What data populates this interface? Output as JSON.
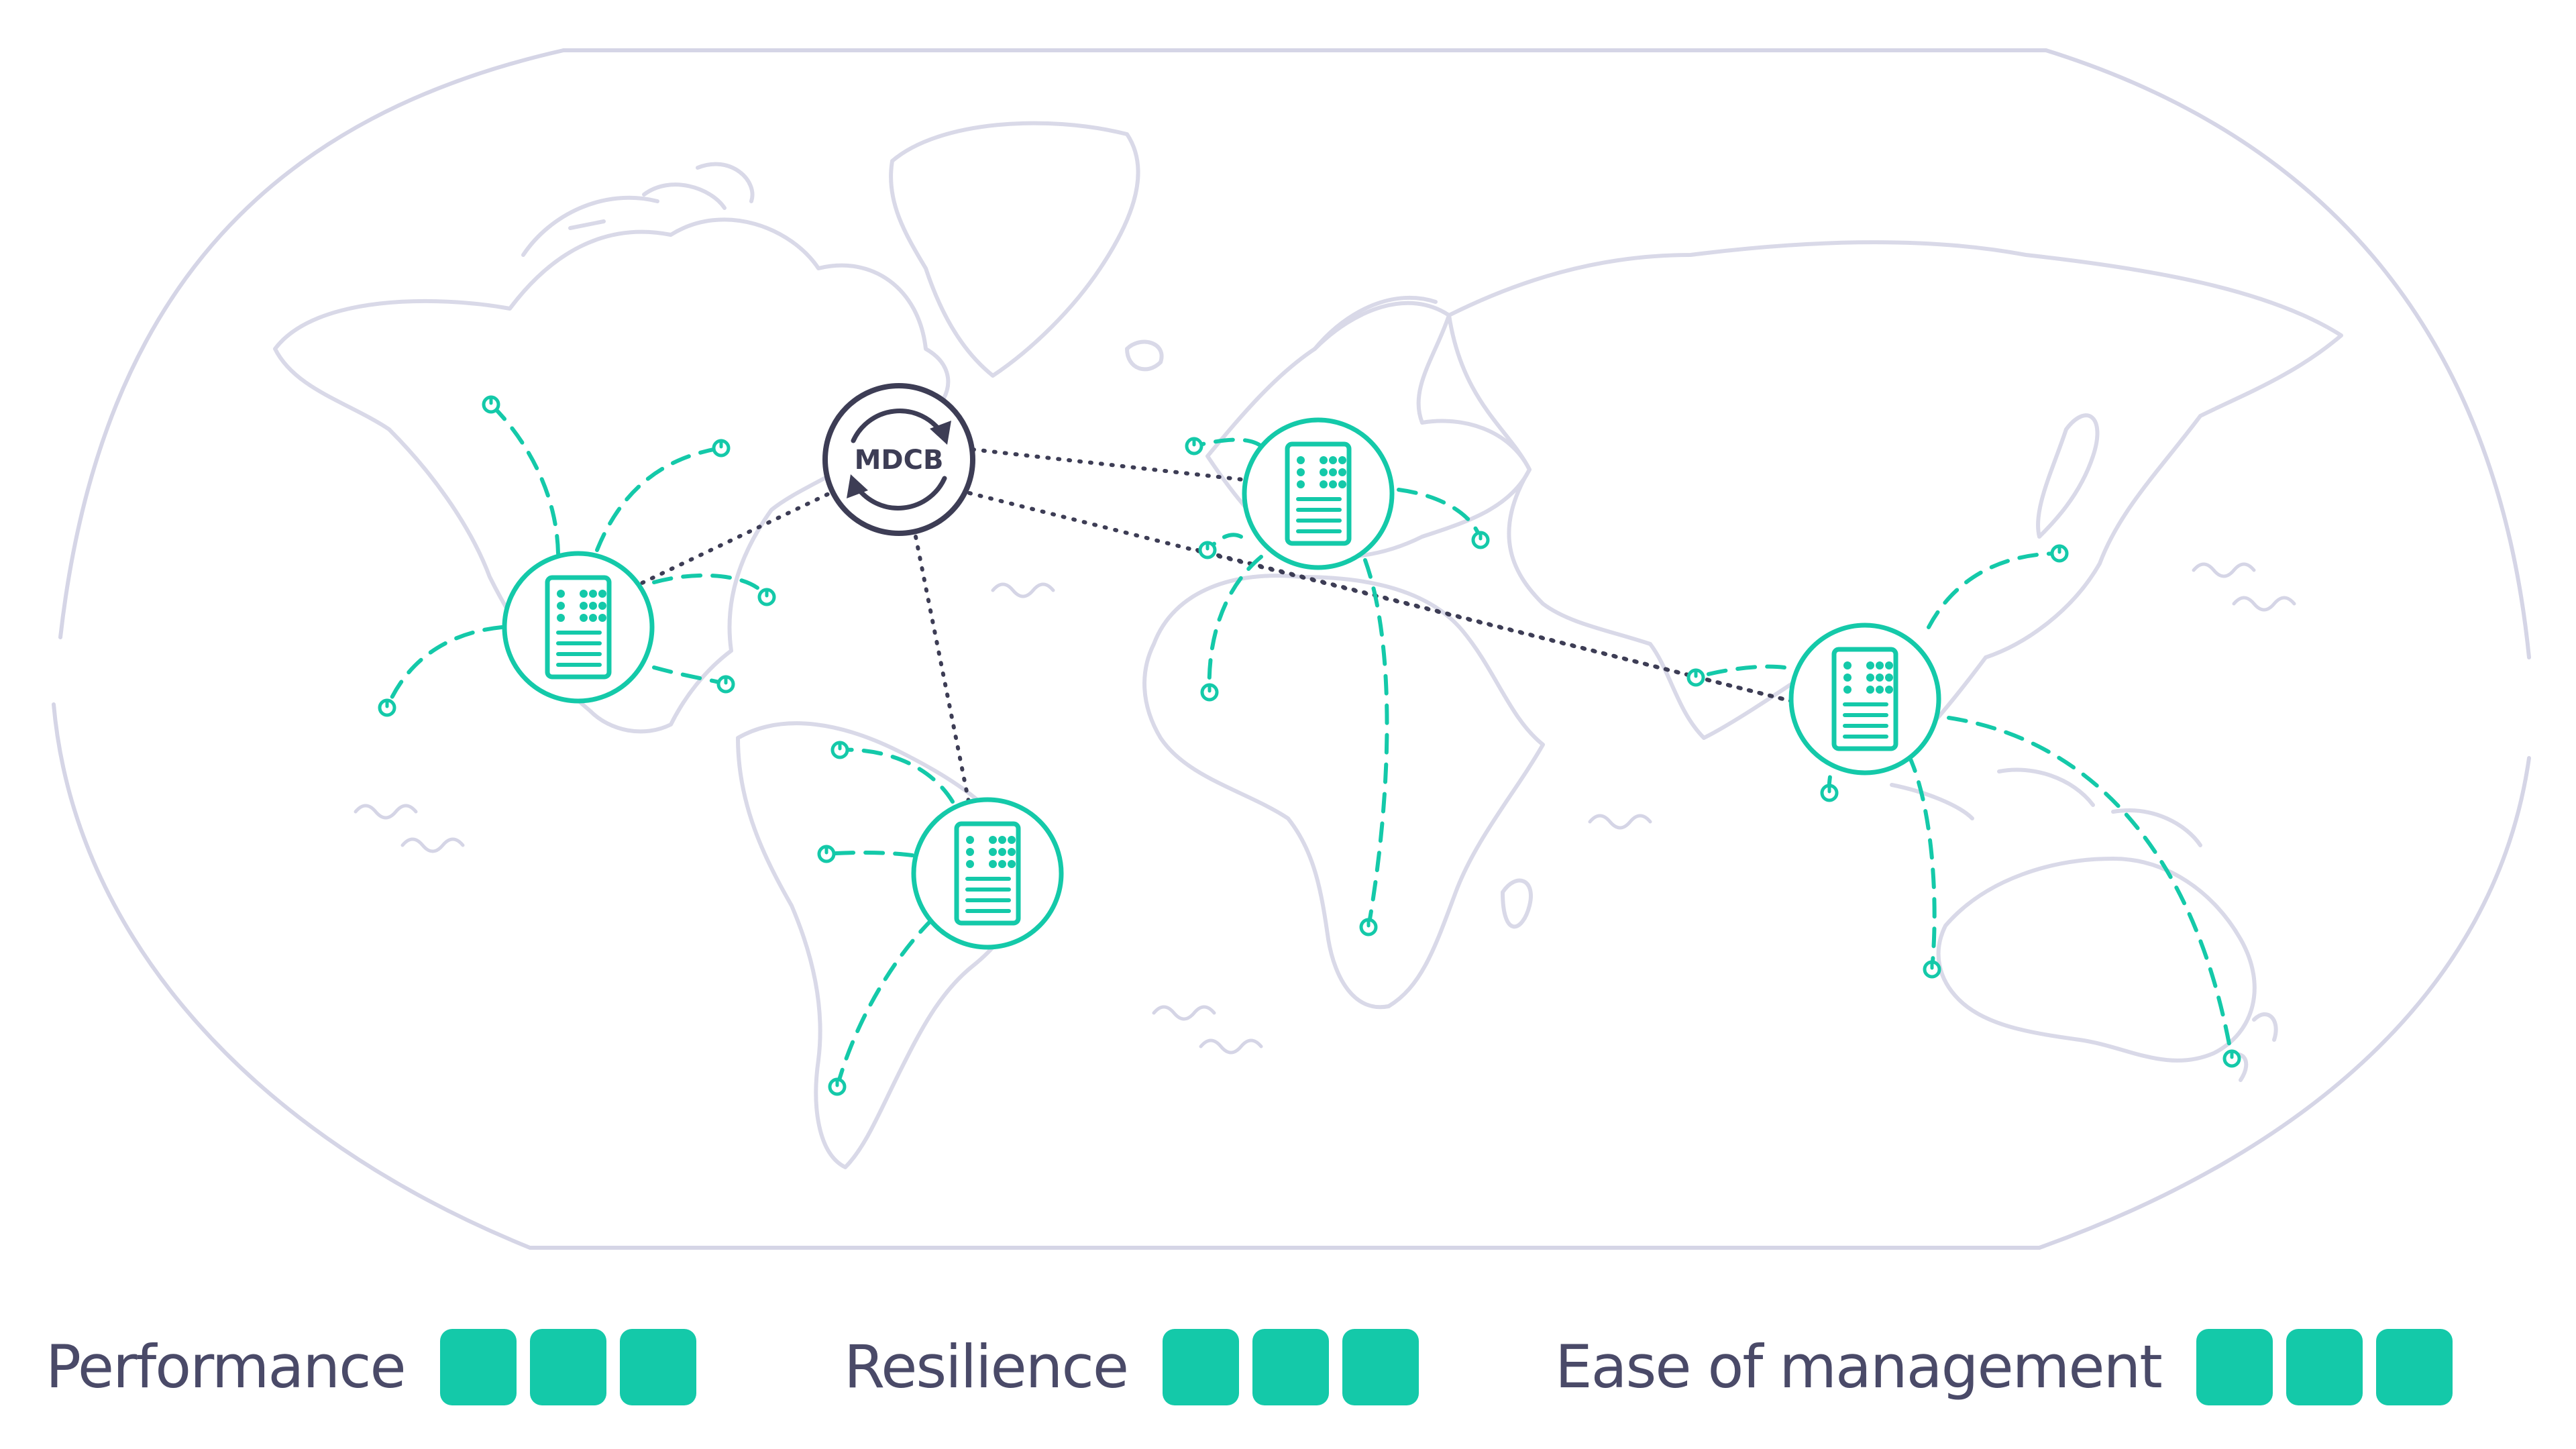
{
  "diagram": {
    "hub": {
      "label": "MDCB"
    },
    "colors": {
      "accent": "#14c9a9",
      "hub_stroke": "#3d3d55",
      "map_outline": "#d5d5e6",
      "label_text": "#4a4a68"
    },
    "icons": {
      "hub": "sync-arrows-icon",
      "data_center": "server-rack-icon",
      "endpoint": "power-endpoint-icon"
    }
  },
  "legend": {
    "metrics": [
      {
        "label": "Performance",
        "rating": 3,
        "max": 3
      },
      {
        "label": "Resilience",
        "rating": 3,
        "max": 3
      },
      {
        "label": "Ease of management",
        "rating": 3,
        "max": 3
      }
    ]
  }
}
